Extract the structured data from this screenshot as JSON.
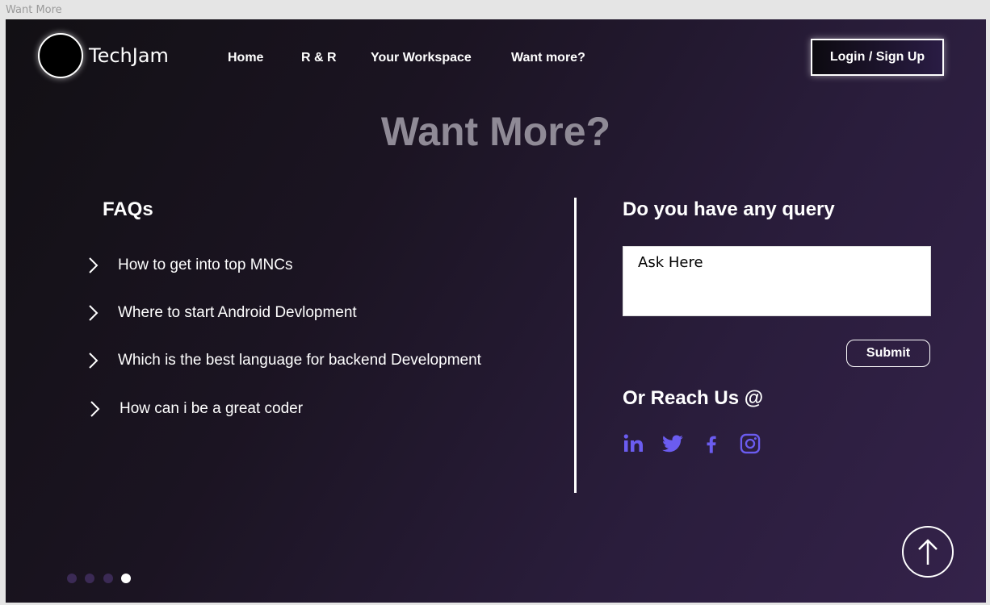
{
  "frame_label": "Want More",
  "brand": "TechJam",
  "nav": [
    "Home",
    "R & R",
    "Your Workspace",
    "Want more?"
  ],
  "login_label": "Login  / Sign Up",
  "page_title": "Want More?",
  "faq": {
    "heading": "FAQs",
    "items": [
      "How to get into top MNCs",
      "Where to start Android Devlopment",
      "Which is the best language for backend Development",
      "How can i be a great coder"
    ]
  },
  "query": {
    "heading": "Do you have any query",
    "placeholder": "Ask Here",
    "submit_label": "Submit"
  },
  "reach": {
    "heading": "Or Reach Us @",
    "icons": [
      "linkedin-icon",
      "twitter-icon",
      "facebook-icon",
      "instagram-icon"
    ],
    "icon_color": "#6b5cf0"
  },
  "carousel": {
    "total": 4,
    "active_index": 3
  },
  "colors": {
    "title": "#8f8a96",
    "social": "#6b5cf0",
    "dot_inactive": "#3b2a55",
    "dot_active": "#ffffff"
  }
}
